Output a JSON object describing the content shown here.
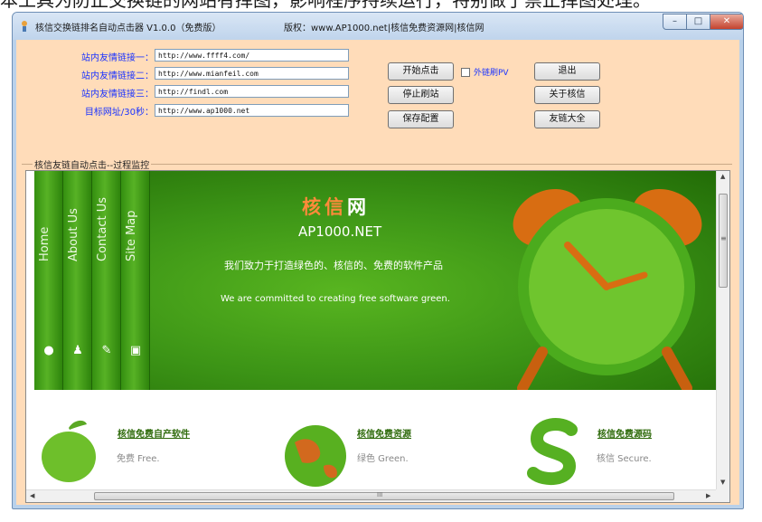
{
  "top_caption": "本工具为防止交换链的网站有挥图，影响程序持续运行，特别做了禁止挥图处理。",
  "window": {
    "title": "核信交换链排名自动点击器 V1.0.0（免费版）",
    "copyright": "版权：www.AP1000.net|核信免费资源网|核信网",
    "min_glyph": "–",
    "max_glyph": "□",
    "close_glyph": "✕"
  },
  "form": {
    "fields": [
      {
        "label": "站内友情链接一：",
        "value": "http://www.ffff4.com/"
      },
      {
        "label": "站内友情链接二：",
        "value": "http://www.mianfeil.com"
      },
      {
        "label": "站内友情链接三：",
        "value": "http://findl.com"
      },
      {
        "label": "目标网址/30秒：",
        "value": "http://www.ap1000.net"
      }
    ],
    "buttons": {
      "start": "开始点击",
      "stop": "停止刷站",
      "save": "保存配置",
      "exit": "退出",
      "about": "关于核信",
      "links": "友链大全"
    },
    "checkbox_label": "外链刷PV",
    "checkbox_checked": false
  },
  "monitor": {
    "group_title": "核信友链自动点击--过程监控",
    "nav_tabs": [
      {
        "label": "Home",
        "icon": "bulb-icon"
      },
      {
        "label": "About Us",
        "icon": "people-icon"
      },
      {
        "label": "Contact Us",
        "icon": "handshake-icon"
      },
      {
        "label": "Site Map",
        "icon": "monitor-icon"
      }
    ],
    "logo_cn_a": "核信",
    "logo_cn_b": "网",
    "logo_en": "AP1000.NET",
    "slogan_cn": "我们致力于打造绿色的、核信的、免费的软件产品",
    "slogan_en": "We are committed to creating free software green.",
    "columns": [
      {
        "link": "核信免费自产软件",
        "desc": "免费 Free."
      },
      {
        "link": "核信免费资源",
        "desc": "绿色 Green."
      },
      {
        "link": "核信免费源码",
        "desc": "核信 Secure."
      }
    ],
    "hscroll_grip": "III",
    "vscroll_grip": "≡"
  },
  "colors": {
    "form_bg": "#ffdcb9",
    "label_blue": "#1a33ff",
    "banner_green": "#3c9416",
    "link_green": "#2f6b0c",
    "logo_orange": "#ff8a3a"
  }
}
